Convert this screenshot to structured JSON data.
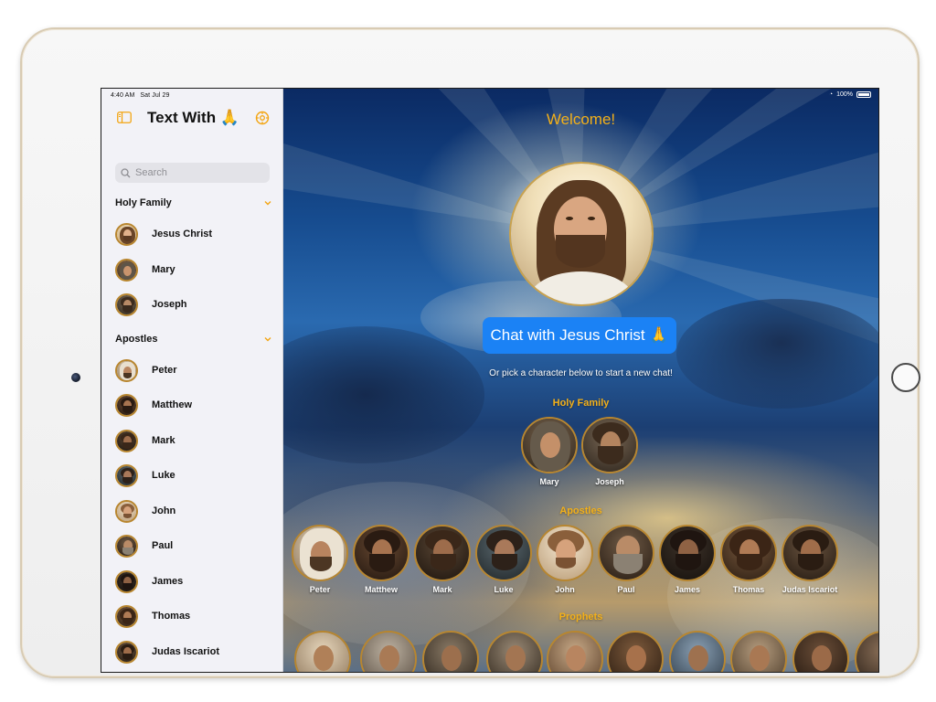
{
  "status_bar": {
    "time": "4:40 AM",
    "date": "Sat Jul 29",
    "battery": "100%"
  },
  "sidebar": {
    "title": "Text With 🙏",
    "search_placeholder": "Search",
    "sections": [
      {
        "title": "Holy Family",
        "items": [
          {
            "name": "Jesus Christ"
          },
          {
            "name": "Mary"
          },
          {
            "name": "Joseph"
          }
        ]
      },
      {
        "title": "Apostles",
        "items": [
          {
            "name": "Peter"
          },
          {
            "name": "Matthew"
          },
          {
            "name": "Mark"
          },
          {
            "name": "Luke"
          },
          {
            "name": "John"
          },
          {
            "name": "Paul"
          },
          {
            "name": "James"
          },
          {
            "name": "Thomas"
          },
          {
            "name": "Judas Iscariot"
          }
        ]
      }
    ]
  },
  "main": {
    "welcome": "Welcome!",
    "chat_button": "Chat with Jesus Christ 🙏",
    "subtitle": "Or pick a character below to start a new chat!",
    "groups": [
      {
        "title": "Holy Family",
        "characters": [
          "Mary",
          "Joseph"
        ]
      },
      {
        "title": "Apostles",
        "characters": [
          "Peter",
          "Matthew",
          "Mark",
          "Luke",
          "John",
          "Paul",
          "James",
          "Thomas",
          "Judas Iscariot"
        ]
      },
      {
        "title": "Prophets",
        "characters": []
      }
    ]
  },
  "colors": {
    "accent": "#f3b019",
    "button": "#1b82f5",
    "sidebar_bg": "#f2f2f7"
  },
  "icons": [
    "sidebar-toggle-icon",
    "settings-icon",
    "search-icon",
    "chevron-down-icon"
  ]
}
